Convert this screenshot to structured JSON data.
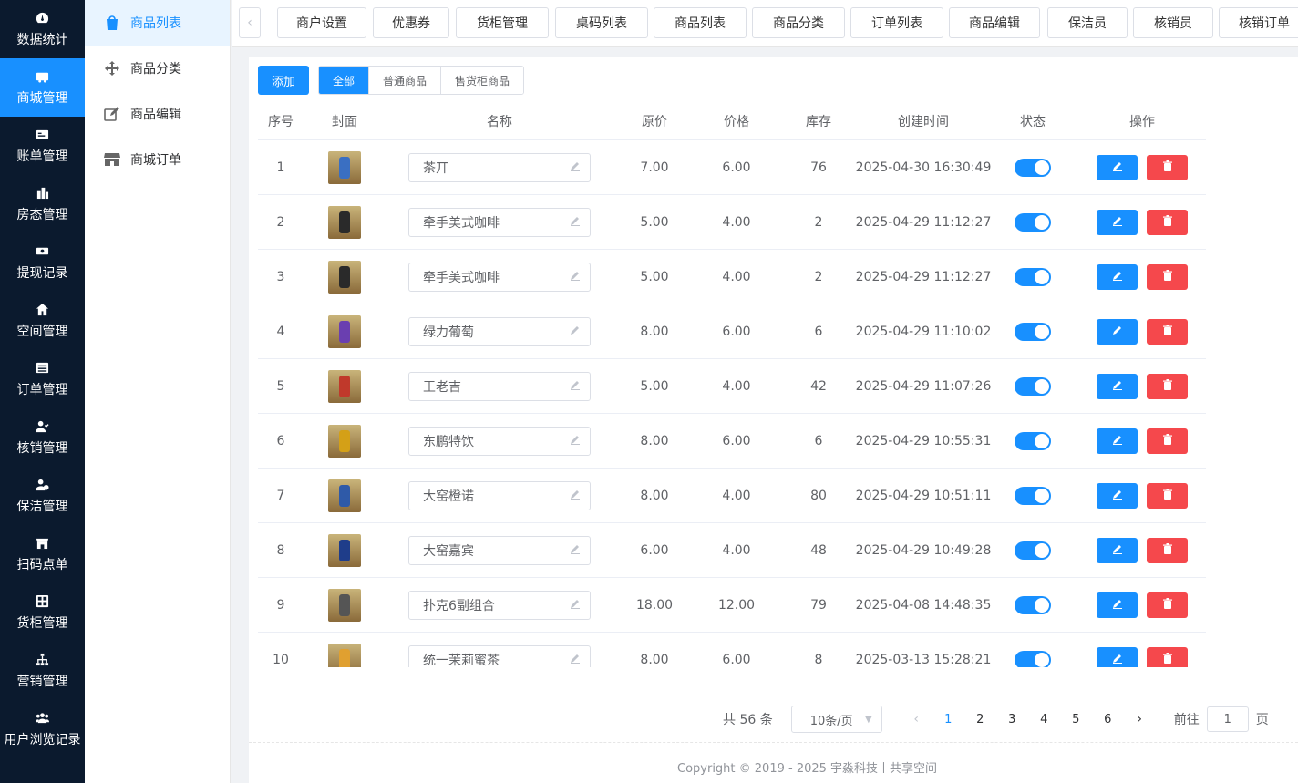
{
  "colors": {
    "accent": "#1890ff",
    "danger": "#f5484c",
    "nav_bg": "#0b1a2e"
  },
  "nav": {
    "items": [
      {
        "label": "数据统计",
        "icon": "dashboard-icon",
        "active": false
      },
      {
        "label": "商城管理",
        "icon": "shop-icon",
        "active": true
      },
      {
        "label": "账单管理",
        "icon": "bill-icon",
        "active": false
      },
      {
        "label": "房态管理",
        "icon": "building-icon",
        "active": false
      },
      {
        "label": "提现记录",
        "icon": "money-icon",
        "active": false
      },
      {
        "label": "空间管理",
        "icon": "home-icon",
        "active": false
      },
      {
        "label": "订单管理",
        "icon": "list-icon",
        "active": false
      },
      {
        "label": "核销管理",
        "icon": "user-check-icon",
        "active": false
      },
      {
        "label": "保洁管理",
        "icon": "user-clock-icon",
        "active": false
      },
      {
        "label": "扫码点单",
        "icon": "store-icon",
        "active": false
      },
      {
        "label": "货柜管理",
        "icon": "grid-icon",
        "active": false
      },
      {
        "label": "营销管理",
        "icon": "sitemap-icon",
        "active": false
      },
      {
        "label": "用户浏览记录",
        "icon": "users-icon",
        "active": false
      }
    ]
  },
  "subnav": {
    "items": [
      {
        "label": "商品列表",
        "icon": "shopping-bag-icon",
        "active": true
      },
      {
        "label": "商品分类",
        "icon": "move-icon",
        "active": false
      },
      {
        "label": "商品编辑",
        "icon": "edit-icon",
        "active": false
      },
      {
        "label": "商城订单",
        "icon": "storefront-icon",
        "active": false
      }
    ]
  },
  "tabs": {
    "prev_arrow": "‹",
    "items": [
      "商户设置",
      "优惠券",
      "货柜管理",
      "桌码列表",
      "商品列表",
      "商品分类",
      "订单列表",
      "商品编辑",
      "保洁员",
      "核销员",
      "核销订单"
    ]
  },
  "toolbar": {
    "add_label": "添加",
    "filters": [
      "全部",
      "普通商品",
      "售货柜商品"
    ],
    "active_filter": 0
  },
  "table": {
    "columns": [
      "序号",
      "封面",
      "名称",
      "原价",
      "价格",
      "库存",
      "创建时间",
      "状态",
      "操作"
    ],
    "rows": [
      {
        "no": "1",
        "name": "茶丌",
        "orig": "7.00",
        "price": "6.00",
        "stock": "76",
        "time": "2025-04-30 16:30:49",
        "enabled": true,
        "thumb_color": "#3a6fc2"
      },
      {
        "no": "2",
        "name": "牵手美式咖啡",
        "orig": "5.00",
        "price": "4.00",
        "stock": "2",
        "time": "2025-04-29 11:12:27",
        "enabled": true,
        "thumb_color": "#2a2a2a"
      },
      {
        "no": "3",
        "name": "牵手美式咖啡",
        "orig": "5.00",
        "price": "4.00",
        "stock": "2",
        "time": "2025-04-29 11:12:27",
        "enabled": true,
        "thumb_color": "#2a2a2a"
      },
      {
        "no": "4",
        "name": "绿力葡萄",
        "orig": "8.00",
        "price": "6.00",
        "stock": "6",
        "time": "2025-04-29 11:10:02",
        "enabled": true,
        "thumb_color": "#6a3fb0"
      },
      {
        "no": "5",
        "name": "王老吉",
        "orig": "5.00",
        "price": "4.00",
        "stock": "42",
        "time": "2025-04-29 11:07:26",
        "enabled": true,
        "thumb_color": "#c0392b"
      },
      {
        "no": "6",
        "name": "东鹏特饮",
        "orig": "8.00",
        "price": "6.00",
        "stock": "6",
        "time": "2025-04-29 10:55:31",
        "enabled": true,
        "thumb_color": "#d4a017"
      },
      {
        "no": "7",
        "name": "大窑橙诺",
        "orig": "8.00",
        "price": "4.00",
        "stock": "80",
        "time": "2025-04-29 10:51:11",
        "enabled": true,
        "thumb_color": "#2f5aa8"
      },
      {
        "no": "8",
        "name": "大窑嘉宾",
        "orig": "6.00",
        "price": "4.00",
        "stock": "48",
        "time": "2025-04-29 10:49:28",
        "enabled": true,
        "thumb_color": "#1f3d8a"
      },
      {
        "no": "9",
        "name": "扑克6副组合",
        "orig": "18.00",
        "price": "12.00",
        "stock": "79",
        "time": "2025-04-08 14:48:35",
        "enabled": true,
        "thumb_color": "#555555"
      },
      {
        "no": "10",
        "name": "统一茉莉蜜茶",
        "orig": "8.00",
        "price": "6.00",
        "stock": "8",
        "time": "2025-03-13 15:28:21",
        "enabled": true,
        "thumb_color": "#e0a030"
      }
    ]
  },
  "pagination": {
    "total": "共 56 条",
    "page_size": "10条/页",
    "pages": [
      "1",
      "2",
      "3",
      "4",
      "5",
      "6"
    ],
    "current": 0,
    "goto_label": "前往",
    "goto_value": "1",
    "goto_suffix": "页"
  },
  "footer": {
    "copyright": "Copyright © 2019 - 2025 宇淼科技丨共享空间"
  }
}
